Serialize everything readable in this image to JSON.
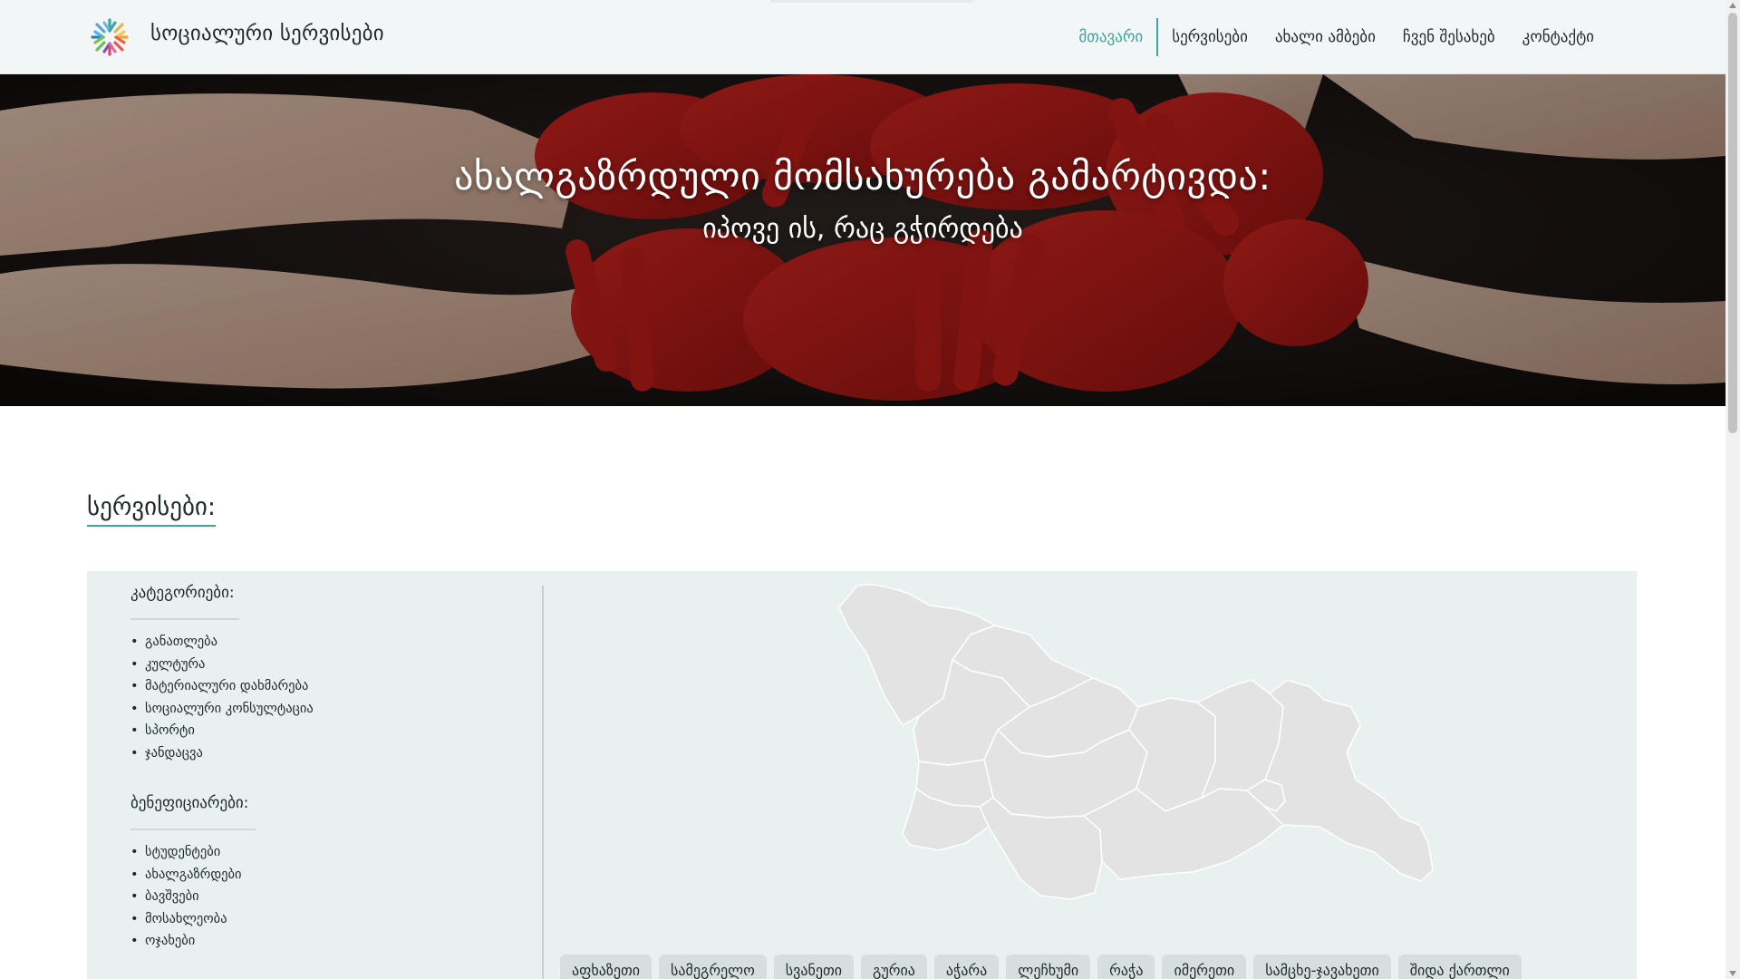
{
  "header": {
    "brand": "სოციალური სერვისები",
    "nav": [
      {
        "label": "მთავარი",
        "active": true
      },
      {
        "label": "სერვისები",
        "active": false
      },
      {
        "label": "ახალი ამბები",
        "active": false
      },
      {
        "label": "ჩვენ შესახებ",
        "active": false
      },
      {
        "label": "კონტაქტი",
        "active": false
      }
    ]
  },
  "hero": {
    "title": "ახალგაზრდული მომსახურება გამარტივდა:",
    "subtitle": "იპოვე ის, რაც გჭირდება"
  },
  "services": {
    "title": "სერვისები:",
    "categories_title": "კატეგორიები:",
    "categories": [
      "განათლება",
      "კულტურა",
      "მატერიალური დახმარება",
      "სოციალური კონსულტაცია",
      "სპორტი",
      "ჯანდაცვა"
    ],
    "beneficiaries_title": "ბენეფიციარები:",
    "beneficiaries": [
      "სტუდენტები",
      "ახალგაზრდები",
      "ბავშვები",
      "მოსახლეობა",
      "ოჯახები"
    ],
    "regions": [
      "აფხაზეთი",
      "სამეგრელო",
      "სვანეთი",
      "გურია",
      "აჭარა",
      "ლეჩხუმი",
      "რაჭა",
      "იმერეთი",
      "სამცხე-ჯავახეთი",
      "შიდა ქართლი"
    ]
  },
  "colors": {
    "accent": "#3aa6a0",
    "panel_bg": "#e8f0f0",
    "chip_bg": "#d6dede",
    "map_fill": "#e3e3e3",
    "map_stroke": "#ffffff"
  }
}
